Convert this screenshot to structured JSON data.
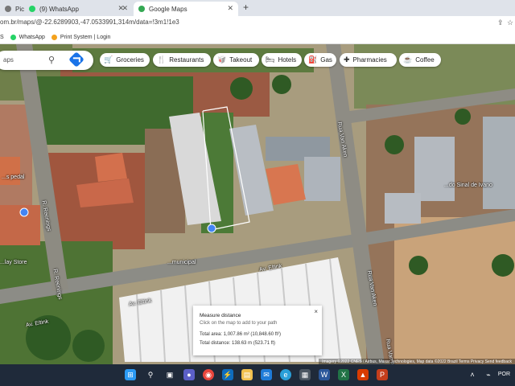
{
  "tabs": [
    {
      "label": "Pic",
      "color": "#777777"
    },
    {
      "label": "(9) WhatsApp",
      "color": "#25d366"
    },
    {
      "label": "Google Maps",
      "color": "#34a853"
    }
  ],
  "address": {
    "url": "om.br/maps/@-22.6289903,-47.0533991,314m/data=!3m1!1e3"
  },
  "bookmarks": [
    {
      "label": "IS",
      "color": "#4285f4"
    },
    {
      "label": "WhatsApp",
      "color": "#25d366"
    },
    {
      "label": "Print System | Login",
      "color": "#f4a21d"
    }
  ],
  "search": {
    "placeholder": "aps"
  },
  "chips": [
    {
      "label": "Groceries",
      "icon": "cart-icon"
    },
    {
      "label": "Restaurants",
      "icon": "fork-knife-icon"
    },
    {
      "label": "Takeout",
      "icon": "takeout-icon"
    },
    {
      "label": "Hotels",
      "icon": "bed-icon"
    },
    {
      "label": "Gas",
      "icon": "gas-pump-icon"
    },
    {
      "label": "Pharmacies",
      "icon": "pharmacy-icon"
    },
    {
      "label": "Coffee",
      "icon": "coffee-cup-icon"
    }
  ],
  "map_labels": {
    "av_eltink_1": "Av. Eltink",
    "av_eltink_2": "Av. Eltink",
    "av_eltink_3": "Av. Eltink",
    "r_reenings_1": "R. Reenings",
    "r_reenings_2": "R. Reenings",
    "rua_van_aken_1": "Rua Van Aken",
    "rua_van_aken_2": "Rua Van Aken",
    "rua_van_aken_3": "Rua Van Aken",
    "poi_1": "...s pedal",
    "poi_2": "...lay Store",
    "poi_3": "...municipal",
    "poi_4": "...do Sinal de Ivano"
  },
  "measure": {
    "title": "Measure distance",
    "hint": "Click on the map to add to your path",
    "area": "Total area: 1,007.86 m² (10,848.60 ft²)",
    "distance": "Total distance: 138.63 m (523.71 ft)",
    "close": "×"
  },
  "attribution": "Imagery ©2022 CNES / Airbus, Maxar Technologies, Map data ©2022   Brazil   Terms   Privacy   Send feedback",
  "taskbar": {
    "language": "POR"
  }
}
